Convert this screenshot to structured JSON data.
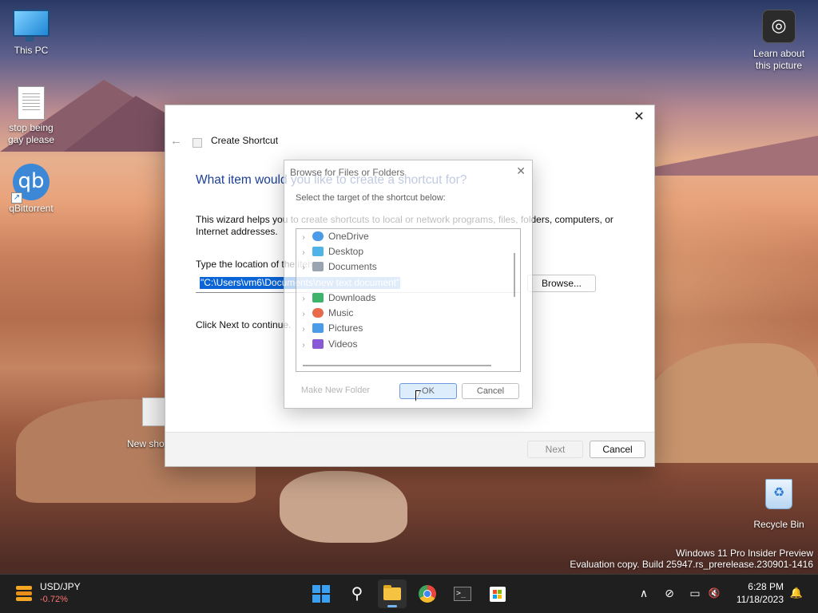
{
  "desktop": {
    "icons": [
      {
        "label": "This PC"
      },
      {
        "label": "stop being gay please"
      },
      {
        "label": "qBittorrent"
      },
      {
        "label": "Learn about this picture"
      },
      {
        "label": "Recycle Bin"
      },
      {
        "label": "New sho"
      }
    ],
    "watermark": {
      "line1": "Windows 11 Pro Insider Preview",
      "line2": "Evaluation copy. Build 25947.rs_prerelease.230901-1416"
    }
  },
  "wizard": {
    "title": "Create Shortcut",
    "close_glyph": "✕",
    "back_glyph": "←",
    "question": "What item would you like to create a shortcut for?",
    "help_text": "This wizard helps you to create shortcuts to local or network programs, files, folders, computers, or Internet addresses.",
    "location_label": "Type the location of the item:",
    "location_value": "\"C:\\Users\\vm6\\Documents\\new text document\"",
    "browse_label": "Browse...",
    "continue_text": "Click Next to continue.",
    "next_label": "Next",
    "cancel_label": "Cancel"
  },
  "browse_dialog": {
    "title": "Browse for Files or Folders",
    "close_glyph": "✕",
    "instruction": "Select the target of the shortcut below:",
    "items": [
      {
        "label": "OneDrive",
        "color": "#4a9be8"
      },
      {
        "label": "Desktop",
        "color": "#4fb3e8"
      },
      {
        "label": "Documents",
        "color": "#9aa4b0"
      },
      {
        "label": "Downloads",
        "color": "#3db36b"
      },
      {
        "label": "Music",
        "color": "#e86a4a"
      },
      {
        "label": "Pictures",
        "color": "#4a9be8"
      },
      {
        "label": "Videos",
        "color": "#8a5ad6"
      }
    ],
    "new_folder_label": "Make New Folder",
    "ok_label": "OK",
    "cancel_label": "Cancel"
  },
  "taskbar": {
    "widget": {
      "title": "USD/JPY",
      "change": "-0.72%"
    },
    "search_glyph": "⚲",
    "terminal_glyph": ">_",
    "tray": {
      "chevron_glyph": "∧",
      "network_glyph": "⊘",
      "display_glyph": "▭",
      "volume_glyph": "🔇",
      "bell_glyph": "🔔"
    },
    "clock": {
      "time": "6:28 PM",
      "date": "11/18/2023"
    }
  }
}
